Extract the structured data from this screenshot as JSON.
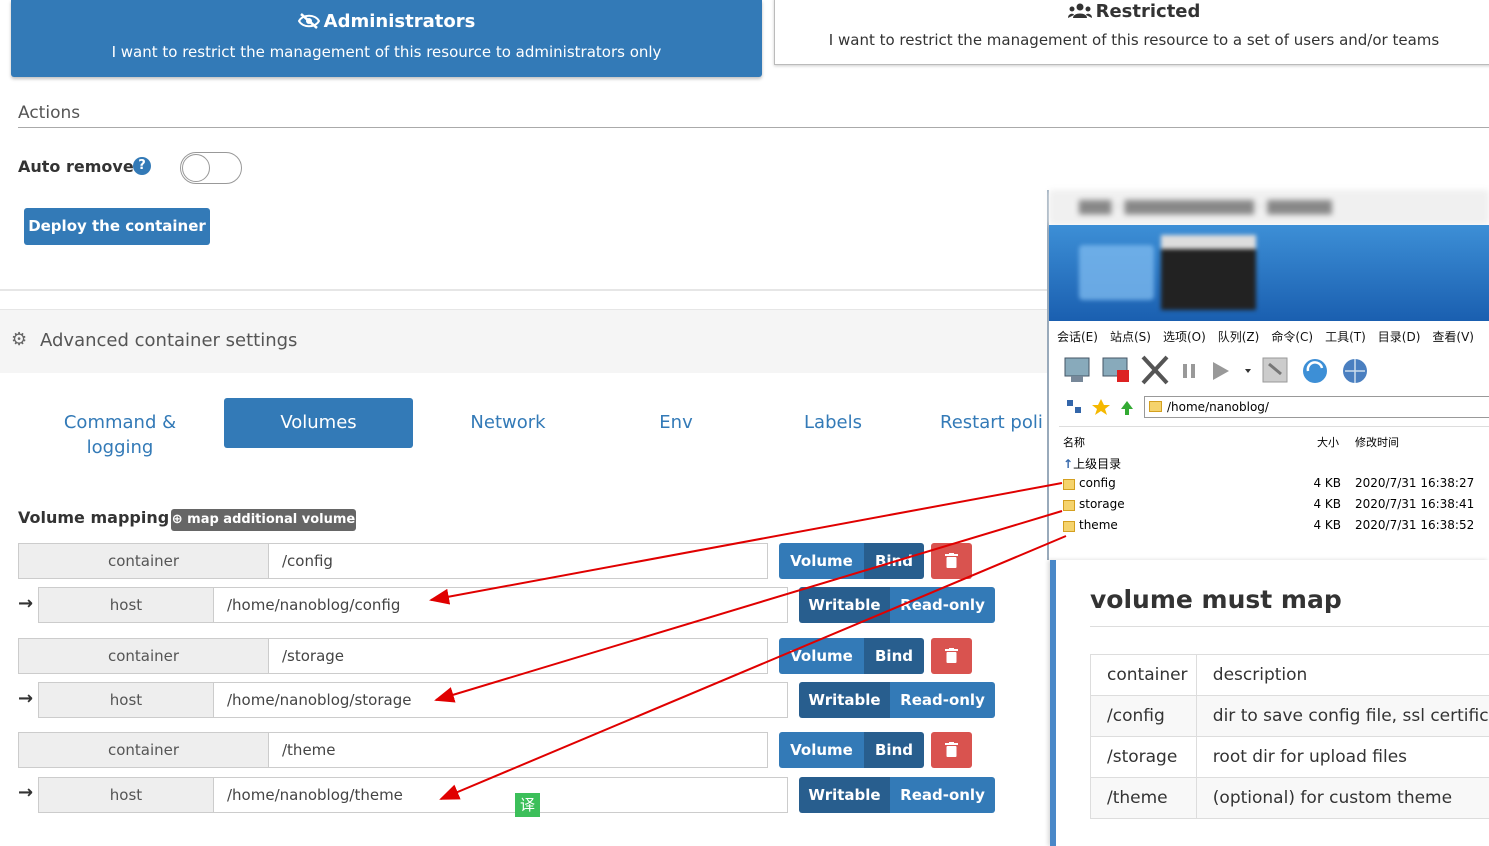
{
  "access_control": {
    "admin": {
      "title": "Administrators",
      "desc": "I want to restrict the management of this resource to administrators only"
    },
    "restricted": {
      "title": "Restricted",
      "desc": "I want to restrict the management of this resource to a set of users and/or teams"
    }
  },
  "actions": {
    "section_title": "Actions",
    "auto_remove_label": "Auto remove",
    "help_glyph": "?",
    "auto_remove_enabled": false,
    "deploy_button": "Deploy the container"
  },
  "advanced": {
    "title": "Advanced container settings",
    "tabs": [
      {
        "label": "Command & logging"
      },
      {
        "label": "Volumes",
        "active": true
      },
      {
        "label": "Network"
      },
      {
        "label": "Env"
      },
      {
        "label": "Labels"
      },
      {
        "label": "Restart poli"
      }
    ]
  },
  "volumes": {
    "title": "Volume mapping",
    "add_button": "map additional volume",
    "container_label": "container",
    "host_label": "host",
    "arrow_glyph": "→",
    "volume_label": "Volume",
    "bind_label": "Bind",
    "writable_label": "Writable",
    "readonly_label": "Read-only",
    "mappings": [
      {
        "container": "/config",
        "host": "/home/nanoblog/config"
      },
      {
        "container": "/storage",
        "host": "/home/nanoblog/storage"
      },
      {
        "container": "/theme",
        "host": "/home/nanoblog/theme"
      }
    ]
  },
  "ftp": {
    "menu": [
      "会话(E)",
      "站点(S)",
      "选项(O)",
      "队列(Z)",
      "命令(C)",
      "工具(T)",
      "目录(D)",
      "查看(V)"
    ],
    "path": "/home/nanoblog/",
    "columns": {
      "name": "名称",
      "size": "大小",
      "modified": "修改时间"
    },
    "parent_dir": "上级目录",
    "files": [
      {
        "name": "config",
        "size": "4 KB",
        "modified": "2020/7/31 16:38:27"
      },
      {
        "name": "storage",
        "size": "4 KB",
        "modified": "2020/7/31 16:38:41"
      },
      {
        "name": "theme",
        "size": "4 KB",
        "modified": "2020/7/31 16:38:52"
      }
    ]
  },
  "docs": {
    "title": "volume must map",
    "headers": [
      "container",
      "description"
    ],
    "rows": [
      [
        "/config",
        "dir to save config file, ssl certifica"
      ],
      [
        "/storage",
        "root dir for upload files"
      ],
      [
        "/theme",
        "(optional) for custom theme"
      ]
    ]
  },
  "translate_badge": "译",
  "colors": {
    "primary": "#337ab7",
    "primary_dark": "#285e8e",
    "danger": "#d9534f",
    "annotation": "#e00000"
  }
}
